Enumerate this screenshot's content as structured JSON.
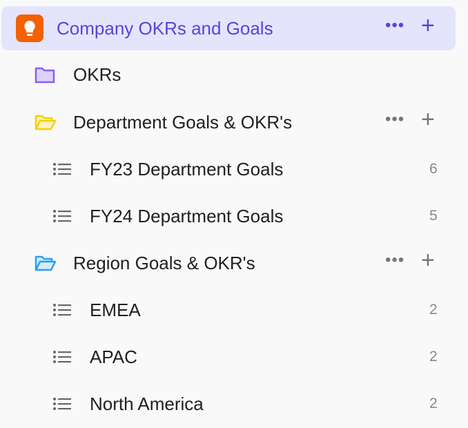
{
  "space": {
    "title": "Company OKRs and Goals",
    "icon": "lightbulb-icon",
    "color": "#f36100"
  },
  "items": [
    {
      "label": "OKRs",
      "type": "folder",
      "color": "#8b5cf6"
    },
    {
      "label": "Department Goals & OKR's",
      "type": "folder-open",
      "color": "#f5d000"
    },
    {
      "label": "FY23 Department Goals",
      "type": "list",
      "count": "6"
    },
    {
      "label": "FY24 Department Goals",
      "type": "list",
      "count": "5"
    },
    {
      "label": "Region Goals & OKR's",
      "type": "folder-open",
      "color": "#2a9ff0"
    },
    {
      "label": "EMEA",
      "type": "list",
      "count": "2"
    },
    {
      "label": "APAC",
      "type": "list",
      "count": "2"
    },
    {
      "label": "North America",
      "type": "list",
      "count": "2"
    }
  ],
  "actions": {
    "more": "•••",
    "add": "+"
  }
}
